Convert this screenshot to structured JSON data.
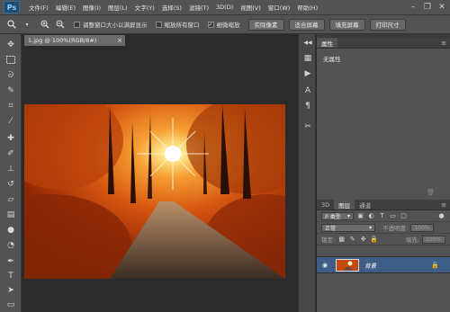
{
  "app": {
    "logo": "Ps",
    "menu": [
      "文件(F)",
      "编辑(E)",
      "图像(I)",
      "图层(L)",
      "文字(Y)",
      "选择(S)",
      "滤镜(T)",
      "3D(D)",
      "视图(V)",
      "窗口(W)",
      "帮助(H)"
    ],
    "window_controls": {
      "minimize": "–",
      "restore": "❐",
      "close": "✕"
    }
  },
  "options_bar": {
    "tool_icon": "zoom-tool-icon",
    "checkboxes": [
      {
        "label": "调整窗口大小以满屏显示",
        "checked": false
      },
      {
        "label": "缩放所有窗口",
        "checked": false
      },
      {
        "label": "细微缩放",
        "checked": true
      }
    ],
    "buttons": [
      "实际像素",
      "适合屏幕",
      "填充屏幕",
      "打印尺寸"
    ]
  },
  "document": {
    "tab_title": "1.jpg @ 100%(RGB/8#)",
    "close_symbol": "×"
  },
  "properties_panel": {
    "tabs": [
      "属性"
    ],
    "empty_text": "无属性"
  },
  "layers_panel": {
    "tabs": [
      "3D",
      "图层",
      "通道"
    ],
    "active_tab": "图层",
    "filter_type": "类型",
    "blend_mode": "正常",
    "opacity_label": "不透明度:",
    "opacity_value": "100%",
    "lock_label": "锁定:",
    "fill_label": "填充:",
    "fill_value": "100%",
    "layers": [
      {
        "name": "背景",
        "visible": true,
        "locked": true
      }
    ]
  },
  "colors": {
    "ui_bg": "#535353",
    "canvas_bg": "#2b2b2b",
    "selected_layer": "#3e5e86",
    "ps_blue": "#8fd0ff"
  }
}
